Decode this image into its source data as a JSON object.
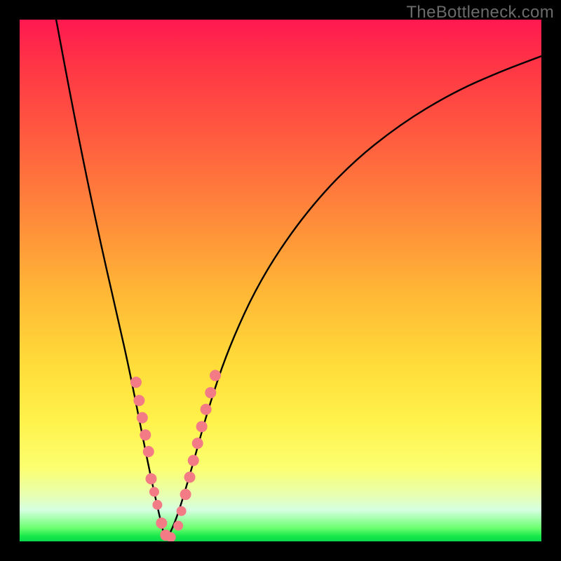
{
  "watermark": "TheBottleneck.com",
  "chart_data": {
    "type": "line",
    "title": "",
    "xlabel": "",
    "ylabel": "",
    "xlim": [
      0,
      100
    ],
    "ylim": [
      0,
      100
    ],
    "background_gradient": {
      "top_color": "#ff1850",
      "mid_colors": [
        "#ff8a3a",
        "#ffdc39",
        "#fbff70"
      ],
      "bottom_color": "#0ad84b"
    },
    "series": [
      {
        "name": "bottleneck-curve",
        "x": [
          7,
          10,
          13,
          16,
          19,
          21,
          23,
          25,
          27,
          28,
          30,
          33,
          36,
          40,
          46,
          54,
          63,
          73,
          83,
          92,
          100
        ],
        "y": [
          100,
          84,
          69,
          55,
          42,
          33,
          23,
          13,
          4,
          0,
          4,
          14,
          25,
          37,
          50,
          62,
          72,
          80,
          86,
          90,
          93
        ]
      }
    ],
    "markers": [
      {
        "name": "left-cluster",
        "color": "#f27b86",
        "points": [
          {
            "x": 22.3,
            "y": 30.5,
            "r": 8
          },
          {
            "x": 22.9,
            "y": 27.0,
            "r": 8
          },
          {
            "x": 23.5,
            "y": 23.7,
            "r": 8
          },
          {
            "x": 24.1,
            "y": 20.4,
            "r": 8
          },
          {
            "x": 24.7,
            "y": 17.2,
            "r": 8
          },
          {
            "x": 25.2,
            "y": 12.0,
            "r": 8
          },
          {
            "x": 25.8,
            "y": 9.5,
            "r": 7
          },
          {
            "x": 26.4,
            "y": 7.0,
            "r": 7
          },
          {
            "x": 27.2,
            "y": 3.5,
            "r": 8
          },
          {
            "x": 28.0,
            "y": 1.2,
            "r": 8
          },
          {
            "x": 29.0,
            "y": 0.8,
            "r": 7
          }
        ]
      },
      {
        "name": "right-cluster",
        "color": "#f27b86",
        "points": [
          {
            "x": 30.4,
            "y": 3.0,
            "r": 7
          },
          {
            "x": 31.0,
            "y": 5.8,
            "r": 7
          },
          {
            "x": 31.8,
            "y": 9.0,
            "r": 8
          },
          {
            "x": 32.6,
            "y": 12.3,
            "r": 8
          },
          {
            "x": 33.3,
            "y": 15.5,
            "r": 8
          },
          {
            "x": 34.1,
            "y": 18.8,
            "r": 8
          },
          {
            "x": 34.9,
            "y": 22.0,
            "r": 8
          },
          {
            "x": 35.7,
            "y": 25.3,
            "r": 8
          },
          {
            "x": 36.6,
            "y": 28.5,
            "r": 8
          },
          {
            "x": 37.5,
            "y": 31.8,
            "r": 8
          }
        ]
      }
    ]
  }
}
